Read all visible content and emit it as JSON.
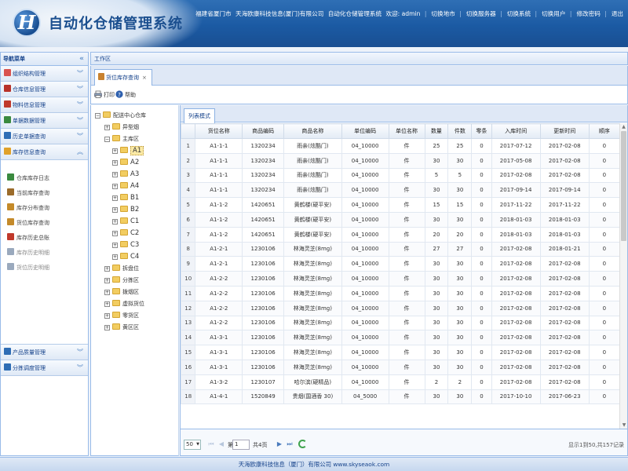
{
  "header": {
    "app_title": "自动化仓储管理系统",
    "logo_letter": "H",
    "location": "福建省厦门市",
    "company": "天海欧康科技信息(厦门)有限公司",
    "system_name": "自动化仓储管理系统",
    "welcome": "欢迎: admin",
    "links": [
      "切换地市",
      "切换服务器",
      "切换系统",
      "切换用户",
      "修改密码",
      "退出"
    ]
  },
  "nav": {
    "title": "导航菜单",
    "groups_top": [
      {
        "label": "组织结构管理",
        "color": "#d9534f"
      },
      {
        "label": "仓库信息管理",
        "color": "#b8322a"
      },
      {
        "label": "物料信息管理",
        "color": "#c0392b"
      },
      {
        "label": "单据数据管理",
        "color": "#3a8a3f"
      },
      {
        "label": "历史单据查询",
        "color": "#2e6db5"
      },
      {
        "label": "库存信息查询",
        "color": "#e0a12a"
      }
    ],
    "sub_items": [
      {
        "label": "仓库库存日志",
        "color": "#3a8a3f"
      },
      {
        "label": "当前库存查询",
        "color": "#9b6b2a"
      },
      {
        "label": "库存分布查询",
        "color": "#c48a2a"
      },
      {
        "label": "货位库存查询",
        "color": "#c48a2a"
      },
      {
        "label": "库存历史总账",
        "color": "#c0392b"
      },
      {
        "label": "库存历史明细",
        "color": "#9aa9bd"
      },
      {
        "label": "货位历史明细",
        "color": "#9aa9bd"
      }
    ],
    "groups_bottom": [
      {
        "label": "产品质量管理",
        "color": "#2e6db5"
      },
      {
        "label": "分拣调度管理",
        "color": "#2e6db5"
      }
    ]
  },
  "work": {
    "title": "工作区",
    "tab_label": "货位库存查询",
    "tab_close": "×",
    "print_label": "打印",
    "help_label": "帮助",
    "grid_tab": "列表模式"
  },
  "tree": {
    "root": "配送中心仓库",
    "areas": [
      "异型烟",
      "主库区"
    ],
    "locations": [
      "A1",
      "A2",
      "A3",
      "A4",
      "B1",
      "B2",
      "C1",
      "C2",
      "C3",
      "C4"
    ],
    "others": [
      "拆盘位",
      "分拣区",
      "拨烟区",
      "虚拟货位",
      "零货区",
      "黄区区"
    ],
    "selected": "A1"
  },
  "grid": {
    "columns": [
      "货位名称",
      "商品编码",
      "商品名称",
      "单位编码",
      "单位名称",
      "数量",
      "件数",
      "零条",
      "入库时间",
      "更新时间",
      "顺序"
    ],
    "rows": [
      [
        "1",
        "A1-1-1",
        "1320234",
        "雨亲(炫酷门)",
        "04_10000",
        "件",
        "25",
        "25",
        "0",
        "2017-07-12",
        "2017-02-08",
        "0"
      ],
      [
        "2",
        "A1-1-1",
        "1320234",
        "雨亲(炫酷门)",
        "04_10000",
        "件",
        "30",
        "30",
        "0",
        "2017-05-08",
        "2017-02-08",
        "0"
      ],
      [
        "3",
        "A1-1-1",
        "1320234",
        "雨亲(炫酷门)",
        "04_10000",
        "件",
        "5",
        "5",
        "0",
        "2017-02-08",
        "2017-02-08",
        "0"
      ],
      [
        "4",
        "A1-1-1",
        "1320234",
        "雨亲(炫酷门)",
        "04_10000",
        "件",
        "30",
        "30",
        "0",
        "2017-09-14",
        "2017-09-14",
        "0"
      ],
      [
        "5",
        "A1-1-2",
        "1420651",
        "黄鹤楼(硬平安)",
        "04_10000",
        "件",
        "15",
        "15",
        "0",
        "2017-11-22",
        "2017-11-22",
        "0"
      ],
      [
        "6",
        "A1-1-2",
        "1420651",
        "黄鹤楼(硬平安)",
        "04_10000",
        "件",
        "30",
        "30",
        "0",
        "2018-01-03",
        "2018-01-03",
        "0"
      ],
      [
        "7",
        "A1-1-2",
        "1420651",
        "黄鹤楼(硬平安)",
        "04_10000",
        "件",
        "20",
        "20",
        "0",
        "2018-01-03",
        "2018-01-03",
        "0"
      ],
      [
        "8",
        "A1-2-1",
        "1230106",
        "林海灵芝(8mg)",
        "04_10000",
        "件",
        "27",
        "27",
        "0",
        "2017-02-08",
        "2018-01-21",
        "0"
      ],
      [
        "9",
        "A1-2-1",
        "1230106",
        "林海灵芝(8mg)",
        "04_10000",
        "件",
        "30",
        "30",
        "0",
        "2017-02-08",
        "2017-02-08",
        "0"
      ],
      [
        "10",
        "A1-2-2",
        "1230106",
        "林海灵芝(8mg)",
        "04_10000",
        "件",
        "30",
        "30",
        "0",
        "2017-02-08",
        "2017-02-08",
        "0"
      ],
      [
        "11",
        "A1-2-2",
        "1230106",
        "林海灵芝(8mg)",
        "04_10000",
        "件",
        "30",
        "30",
        "0",
        "2017-02-08",
        "2017-02-08",
        "0"
      ],
      [
        "12",
        "A1-2-2",
        "1230106",
        "林海灵芝(8mg)",
        "04_10000",
        "件",
        "30",
        "30",
        "0",
        "2017-02-08",
        "2017-02-08",
        "0"
      ],
      [
        "13",
        "A1-2-2",
        "1230106",
        "林海灵芝(8mg)",
        "04_10000",
        "件",
        "30",
        "30",
        "0",
        "2017-02-08",
        "2017-02-08",
        "0"
      ],
      [
        "14",
        "A1-3-1",
        "1230106",
        "林海灵芝(8mg)",
        "04_10000",
        "件",
        "30",
        "30",
        "0",
        "2017-02-08",
        "2017-02-08",
        "0"
      ],
      [
        "15",
        "A1-3-1",
        "1230106",
        "林海灵芝(8mg)",
        "04_10000",
        "件",
        "30",
        "30",
        "0",
        "2017-02-08",
        "2017-02-08",
        "0"
      ],
      [
        "16",
        "A1-3-1",
        "1230106",
        "林海灵芝(8mg)",
        "04_10000",
        "件",
        "30",
        "30",
        "0",
        "2017-02-08",
        "2017-02-08",
        "0"
      ],
      [
        "17",
        "A1-3-2",
        "1230107",
        "哈尔滨(硬精品)",
        "04_10000",
        "件",
        "2",
        "2",
        "0",
        "2017-02-08",
        "2017-02-08",
        "0"
      ],
      [
        "18",
        "A1-4-1",
        "1520849",
        "贵烟(国酒香 30)",
        "04_5000",
        "件",
        "30",
        "30",
        "0",
        "2017-10-10",
        "2017-06-23",
        "0"
      ]
    ]
  },
  "pager": {
    "page_size": "50",
    "page_prefix": "第",
    "current_page": "1",
    "page_suffix": "共4页",
    "info": "显示1到50,共157记录"
  },
  "footer": {
    "text": "天海欧康科技信息（厦门）有限公司 www.skyseaok.com"
  }
}
